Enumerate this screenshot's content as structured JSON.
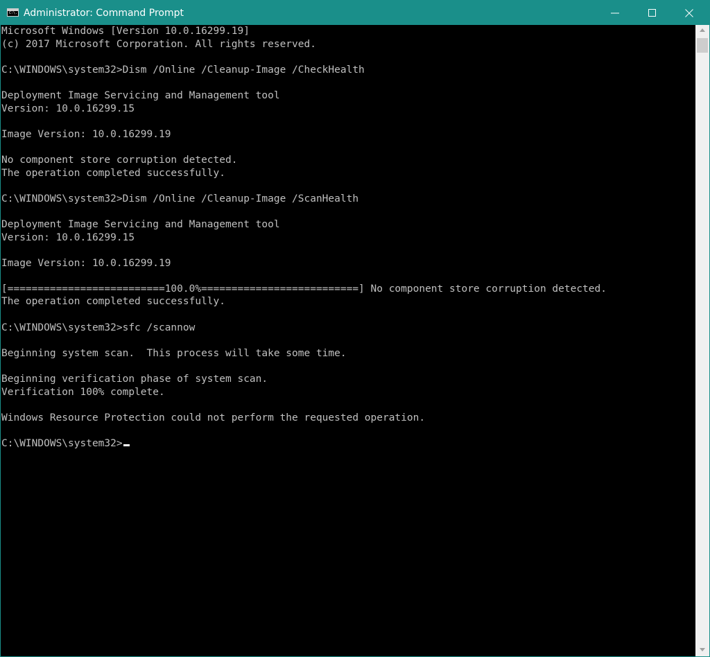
{
  "window": {
    "title": "Administrator: Command Prompt",
    "app_icon_text": "C:\\.",
    "colors": {
      "titlebar": "#1a8f8a",
      "console_bg": "#000000",
      "console_text": "#c0c0c0",
      "scrollbar_bg": "#f0f0f0",
      "scroll_thumb": "#cdcdcd"
    }
  },
  "caption_buttons": {
    "minimize_icon": "minimize-icon",
    "maximize_icon": "maximize-icon",
    "close_icon": "close-icon"
  },
  "console": {
    "lines": [
      "Microsoft Windows [Version 10.0.16299.19]",
      "(c) 2017 Microsoft Corporation. All rights reserved.",
      "",
      "C:\\WINDOWS\\system32>Dism /Online /Cleanup-Image /CheckHealth",
      "",
      "Deployment Image Servicing and Management tool",
      "Version: 10.0.16299.15",
      "",
      "Image Version: 10.0.16299.19",
      "",
      "No component store corruption detected.",
      "The operation completed successfully.",
      "",
      "C:\\WINDOWS\\system32>Dism /Online /Cleanup-Image /ScanHealth",
      "",
      "Deployment Image Servicing and Management tool",
      "Version: 10.0.16299.15",
      "",
      "Image Version: 10.0.16299.19",
      "",
      "[==========================100.0%==========================] No component store corruption detected.",
      "The operation completed successfully.",
      "",
      "C:\\WINDOWS\\system32>sfc /scannow",
      "",
      "Beginning system scan.  This process will take some time.",
      "",
      "Beginning verification phase of system scan.",
      "Verification 100% complete.",
      "",
      "Windows Resource Protection could not perform the requested operation.",
      "",
      "C:\\WINDOWS\\system32>"
    ]
  },
  "scrollbar": {
    "up_icon": "scroll-up-arrow-icon",
    "down_icon": "scroll-down-arrow-icon"
  }
}
